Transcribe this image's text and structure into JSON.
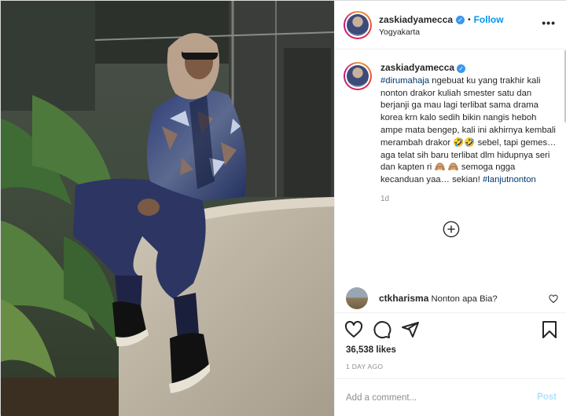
{
  "post": {
    "author": "zaskiadyamecca",
    "location": "Yogyakarta",
    "follow_label": "Follow",
    "more_label": "•••",
    "dot": "•"
  },
  "caption": {
    "author": "zaskiadyamecca",
    "hashtag": "#dirumahaja",
    "text": " ngebuat ku yang trakhir kali nonton drakor kuliah smester satu dan berjanji ga mau lagi terlibat sama drama korea krn kalo sedih bikin nangis heboh ampe mata bengep, kali ini akhirnya kembali merambah drakor 🤣🤣 sebel, tapi gemes… aga telat sih baru terlibat dlm hidupnya seri dan kapten ri 🙈 🙈 semoga ngga kecanduan yaa… sekian! ",
    "hashtag_end": "#lanjutnonton",
    "time": "1d"
  },
  "comment": {
    "author": "ctkharisma",
    "text": "Nonton apa Bia?"
  },
  "stats": {
    "likes": "36,538 likes",
    "posted": "1 DAY AGO"
  },
  "composer": {
    "placeholder": "Add a comment...",
    "post_label": "Post"
  },
  "colors": {
    "accent": "#0095f6",
    "verified": "#3897f0",
    "post_disabled": "#b2dffc"
  }
}
